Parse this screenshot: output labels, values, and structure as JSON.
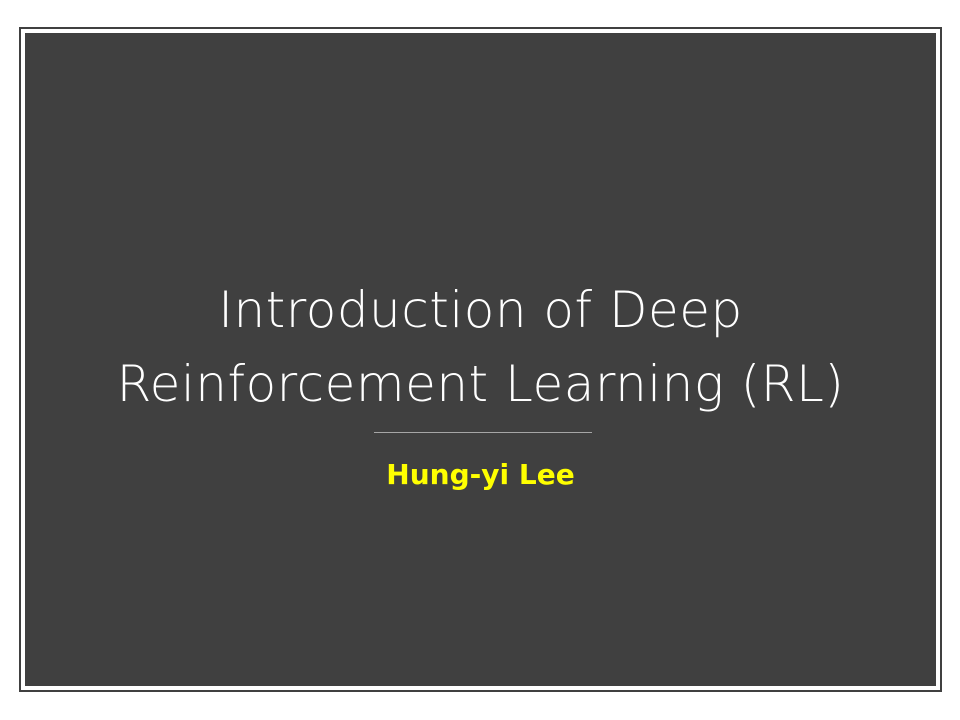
{
  "slide": {
    "title_line1": "Introduction of Deep",
    "title_line2": "Reinforcement Learning (RL)",
    "author": "Hung-yi Lee"
  },
  "colors": {
    "background": "#404040",
    "title_text": "#ffffff",
    "author_text": "#ffff00",
    "divider": "#a6a6a6"
  }
}
